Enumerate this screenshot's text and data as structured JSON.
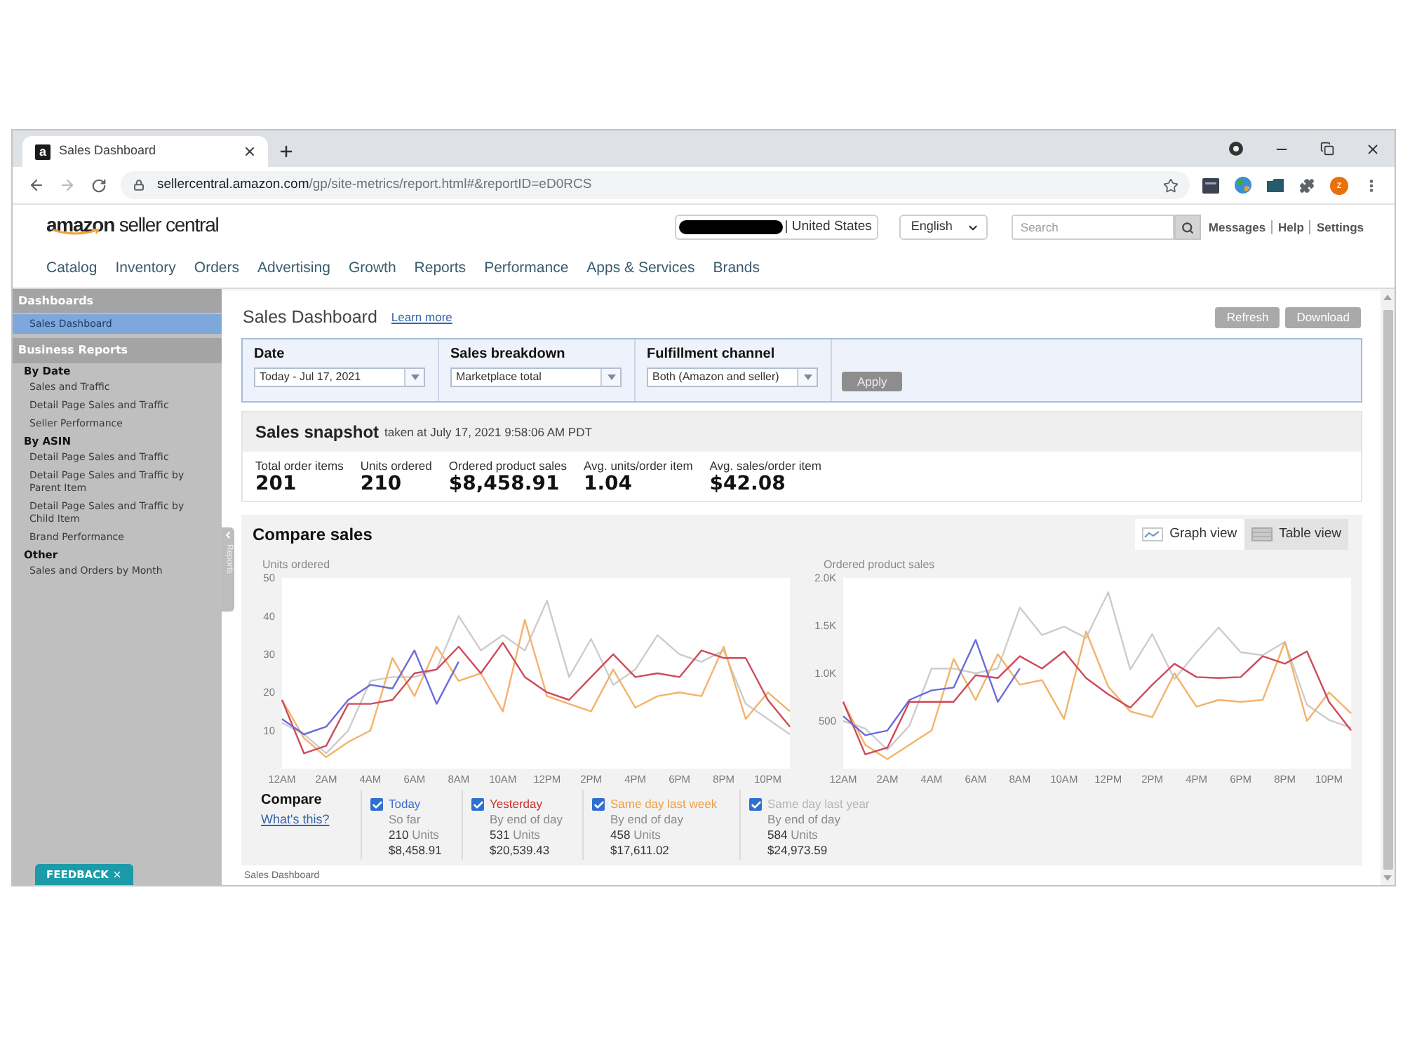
{
  "browser": {
    "tab": {
      "favicon": "a",
      "title": "Sales Dashboard"
    },
    "url": {
      "host": "sellercentral.amazon.com",
      "path": "/gp/site-metrics/report.html#&reportID=eD0RCS"
    },
    "profile_initial": "z"
  },
  "header": {
    "logo": "**amazon** seller central",
    "marketplace": "| United States",
    "language": "English",
    "search": {
      "placeholder": "Search"
    },
    "links": [
      "Messages",
      "Help",
      "Settings"
    ],
    "nav": [
      "Catalog",
      "Inventory",
      "Orders",
      "Advertising",
      "Growth",
      "Reports",
      "Performance",
      "Apps & Services",
      "Brands"
    ]
  },
  "sidebar": {
    "sections": [
      {
        "title": "Dashboards",
        "items": [
          {
            "label": "Sales Dashboard",
            "selected": true
          }
        ]
      },
      {
        "title": "Business Reports",
        "groups": [
          {
            "heading": "By Date",
            "items": [
              {
                "label": "Sales and Traffic",
                "selected": false
              },
              {
                "label": "Detail Page Sales and Traffic",
                "selected": false
              },
              {
                "label": "Seller Performance",
                "selected": false
              }
            ]
          },
          {
            "heading": "By ASIN",
            "items": [
              {
                "label": "Detail Page Sales and Traffic",
                "selected": false
              },
              {
                "label": "Detail Page Sales and Traffic by Parent Item",
                "selected": false
              },
              {
                "label": "Detail Page Sales and Traffic by Child Item",
                "selected": false
              },
              {
                "label": "Brand Performance",
                "selected": false
              }
            ]
          },
          {
            "heading": "Other",
            "items": [
              {
                "label": "Sales and Orders by Month",
                "selected": false
              }
            ]
          }
        ]
      }
    ],
    "collapse_tab": "Reports",
    "feedback": "FEEDBACK"
  },
  "dashboard": {
    "title": "Sales Dashboard",
    "help_link": "Learn more",
    "buttons": [
      "Refresh",
      "Download"
    ]
  },
  "filters": {
    "fields": [
      {
        "label": "Date",
        "value": "Today - Jul 17, 2021"
      },
      {
        "label": "Sales breakdown",
        "value": "Marketplace total"
      },
      {
        "label": "Fulfillment channel",
        "value": "Both (Amazon and seller)"
      }
    ],
    "apply": "Apply"
  },
  "snapshot": {
    "title": "Sales snapshot",
    "taken_at": "taken at July 17, 2021 9:58:06 AM PDT",
    "metrics": [
      {
        "label": "Total order items",
        "value": "201"
      },
      {
        "label": "Units ordered",
        "value": "210"
      },
      {
        "label": "Ordered product sales",
        "value": "$8,458.91"
      },
      {
        "label": "Avg. units/order item",
        "value": "1.04"
      },
      {
        "label": "Avg. sales/order item",
        "value": "$42.08"
      }
    ]
  },
  "compare": {
    "title": "Compare sales",
    "views": [
      {
        "label": "Graph view",
        "kind": "graph",
        "selected": true
      },
      {
        "label": "Table view",
        "kind": "table",
        "selected": false
      }
    ],
    "charts": [
      {
        "chart_data": {
          "type": "line",
          "title": "Units ordered",
          "categories": [
            "12AM",
            null,
            "2AM",
            null,
            "4AM",
            null,
            "6AM",
            null,
            "8AM",
            null,
            "10AM",
            null,
            "12PM",
            null,
            "2PM",
            null,
            "4PM",
            null,
            "6PM",
            null,
            "8PM",
            null,
            "10PM",
            null
          ],
          "ylim": [
            0,
            50
          ],
          "yticks": [
            10,
            20,
            30,
            40,
            50
          ],
          "series": [
            {
              "color": "#6b6bd9",
              "values": [
                13,
                9,
                11,
                18,
                22,
                21,
                31,
                17,
                28,
                null,
                null,
                null,
                null,
                null,
                null,
                null,
                null,
                null,
                null,
                null,
                null,
                null,
                null,
                null
              ]
            },
            {
              "color": "#cf4a5a",
              "values": [
                18,
                4,
                6,
                17,
                17,
                18,
                25,
                26,
                32,
                25,
                33,
                24,
                20,
                18,
                24,
                30,
                24,
                25,
                24,
                31,
                29,
                29,
                18,
                11
              ]
            },
            {
              "color": "#f4b26a",
              "values": [
                18,
                8,
                3,
                7,
                10,
                29,
                19,
                32,
                23,
                25,
                15,
                39,
                19,
                17,
                15,
                26,
                16,
                19,
                20,
                19,
                32,
                13,
                20,
                15
              ]
            },
            {
              "color": "#cccccc",
              "values": [
                12,
                9,
                4,
                10,
                23,
                24,
                24,
                26,
                40,
                31,
                35,
                31,
                44,
                24,
                34,
                22,
                26,
                35,
                30,
                28,
                31,
                17,
                13,
                9
              ]
            }
          ]
        }
      },
      {
        "chart_data": {
          "type": "line",
          "title": "Ordered product sales",
          "categories": [
            "12AM",
            null,
            "2AM",
            null,
            "4AM",
            null,
            "6AM",
            null,
            "8AM",
            null,
            "10AM",
            null,
            "12PM",
            null,
            "2PM",
            null,
            "4PM",
            null,
            "6PM",
            null,
            "8PM",
            null,
            "10PM",
            null
          ],
          "ylim": [
            0,
            2000
          ],
          "yticks": [
            500,
            {
              "value": 1000,
              "label": "1.0K"
            },
            {
              "value": 1500,
              "label": "1.5K"
            },
            {
              "value": 2000,
              "label": "2.0K"
            }
          ],
          "series": [
            {
              "color": "#6b6bd9",
              "values": [
                550,
                350,
                400,
                720,
                820,
                850,
                1350,
                700,
                1050,
                null,
                null,
                null,
                null,
                null,
                null,
                null,
                null,
                null,
                null,
                null,
                null,
                null,
                null,
                null
              ]
            },
            {
              "color": "#cf4a5a",
              "values": [
                700,
                150,
                220,
                700,
                700,
                700,
                980,
                950,
                1180,
                1050,
                1230,
                950,
                780,
                640,
                880,
                1100,
                960,
                950,
                960,
                1180,
                1100,
                1230,
                700,
                400
              ]
            },
            {
              "color": "#f4b26a",
              "values": [
                700,
                250,
                100,
                250,
                400,
                1150,
                720,
                1200,
                880,
                930,
                520,
                1440,
                860,
                600,
                540,
                1000,
                650,
                720,
                700,
                720,
                1330,
                500,
                800,
                580
              ]
            },
            {
              "color": "#cccccc",
              "values": [
                500,
                420,
                200,
                450,
                1050,
                1050,
                1000,
                1050,
                1690,
                1400,
                1490,
                1370,
                1850,
                1040,
                1410,
                940,
                1220,
                1480,
                1220,
                1190,
                1330,
                670,
                510,
                430
              ]
            }
          ]
        }
      }
    ],
    "legend": {
      "heading": "Compare",
      "help_link": "What's this?",
      "items": [
        {
          "label": "Today",
          "checked": true,
          "color": "#3f6fd1",
          "period": "So far",
          "units": "210",
          "units_label": "Units",
          "sales": "$8,458.91"
        },
        {
          "label": "Yesterday",
          "checked": true,
          "color": "#c9302c",
          "period": "By end of day",
          "units": "531",
          "units_label": "Units",
          "sales": "$20,539.43"
        },
        {
          "label": "Same day last week",
          "checked": true,
          "color": "#f0a040",
          "period": "By end of day",
          "units": "458",
          "units_label": "Units",
          "sales": "$17,611.02"
        },
        {
          "label": "Same day last year",
          "checked": true,
          "color": "#b5b5b5",
          "period": "By end of day",
          "units": "584",
          "units_label": "Units",
          "sales": "$24,973.59"
        }
      ]
    }
  },
  "footer": {
    "breadcrumb": "Sales Dashboard"
  }
}
